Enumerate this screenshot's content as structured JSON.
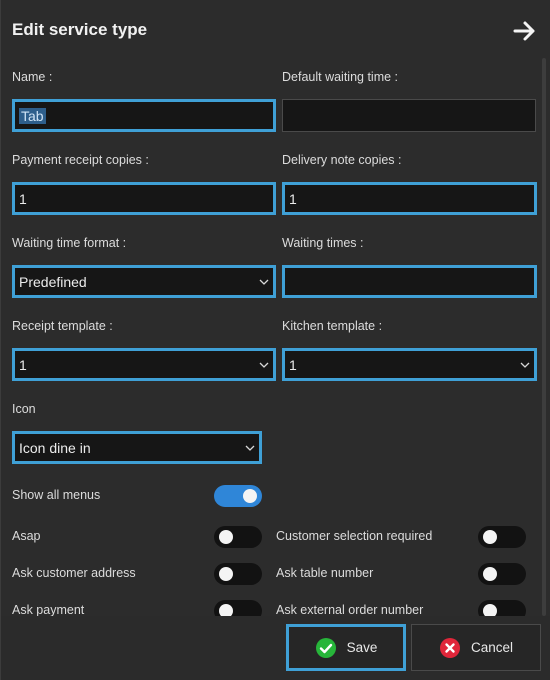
{
  "header": {
    "title": "Edit service type"
  },
  "fields": {
    "name": {
      "label": "Name :",
      "value": "Tab"
    },
    "default_waiting_time": {
      "label": "Default waiting time :",
      "value": ""
    },
    "payment_receipt_copies": {
      "label": "Payment receipt copies :",
      "value": "1"
    },
    "delivery_note_copies": {
      "label": "Delivery note copies :",
      "value": "1"
    },
    "waiting_time_format": {
      "label": "Waiting time format :",
      "value": "Predefined"
    },
    "waiting_times": {
      "label": "Waiting times :",
      "value": ""
    },
    "receipt_template": {
      "label": "Receipt template :",
      "value": "1"
    },
    "kitchen_template": {
      "label": "Kitchen template :",
      "value": "1"
    },
    "icon": {
      "label": "Icon",
      "value": "Icon dine in"
    }
  },
  "toggles": {
    "show_all_menus": {
      "label": "Show all menus",
      "on": true
    },
    "asap": {
      "label": "Asap",
      "on": false
    },
    "customer_selection_required": {
      "label": "Customer selection required",
      "on": false
    },
    "ask_customer_address": {
      "label": "Ask customer address",
      "on": false
    },
    "ask_table_number": {
      "label": "Ask table number",
      "on": false
    },
    "ask_payment": {
      "label": "Ask payment",
      "on": false
    },
    "ask_external_order_number": {
      "label": "Ask external order number",
      "on": false
    }
  },
  "footer": {
    "save_label": "Save",
    "cancel_label": "Cancel"
  },
  "colors": {
    "accent": "#3fa0d6",
    "toggle_on": "#2f86d8",
    "save_icon": "#27b53a",
    "cancel_icon": "#e0263a"
  },
  "icons": {
    "back": "arrow-right-icon",
    "dropdown": "chevron-down-icon",
    "save": "check-circle-icon",
    "cancel": "x-circle-icon"
  }
}
